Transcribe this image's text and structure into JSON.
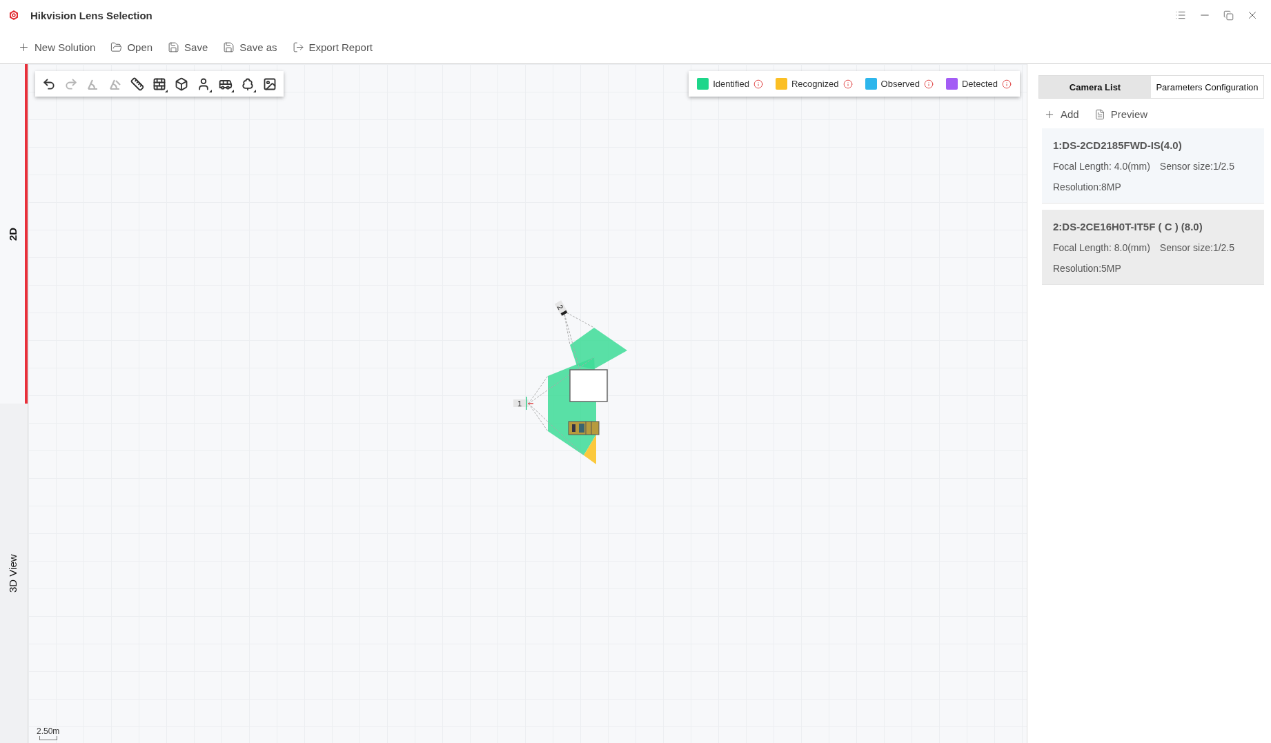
{
  "window": {
    "title": "Hikvision Lens Selection"
  },
  "menu": [
    {
      "kind": "new",
      "label": "New Solution"
    },
    {
      "kind": "open",
      "label": "Open"
    },
    {
      "kind": "save",
      "label": "Save"
    },
    {
      "kind": "saveas",
      "label": "Save as"
    },
    {
      "kind": "export",
      "label": "Export Report"
    }
  ],
  "view_tabs": [
    {
      "label": "2D",
      "selected": true
    },
    {
      "label": "3D View",
      "selected": false
    }
  ],
  "tools": [
    {
      "kind": "undo",
      "disabled": false,
      "submenu": false
    },
    {
      "kind": "redo",
      "disabled": true,
      "submenu": false
    },
    {
      "kind": "angle",
      "disabled": true,
      "submenu": false
    },
    {
      "kind": "angle-cut",
      "disabled": true,
      "submenu": false
    },
    {
      "kind": "ruler",
      "disabled": false,
      "submenu": false
    },
    {
      "kind": "wall",
      "disabled": false,
      "submenu": true
    },
    {
      "kind": "box",
      "disabled": false,
      "submenu": false
    },
    {
      "kind": "person",
      "disabled": false,
      "submenu": true
    },
    {
      "kind": "bus",
      "disabled": false,
      "submenu": true
    },
    {
      "kind": "tree",
      "disabled": false,
      "submenu": true
    },
    {
      "kind": "image",
      "disabled": false,
      "submenu": false
    }
  ],
  "legend": [
    {
      "label": "Identified",
      "color": "#1dd68a"
    },
    {
      "label": "Recognized",
      "color": "#fbbf24"
    },
    {
      "label": "Observed",
      "color": "#2db6ec"
    },
    {
      "label": "Detected",
      "color": "#a35cf5"
    }
  ],
  "canvas": {
    "camera_labels": [
      "1",
      "2"
    ],
    "scale_label": "2.50m"
  },
  "panel_tabs": [
    {
      "label": "Camera List",
      "selected": true
    },
    {
      "label": "Parameters Configuration",
      "selected": false
    }
  ],
  "panel_actions": [
    {
      "kind": "add",
      "label": "Add"
    },
    {
      "kind": "preview",
      "label": "Preview"
    }
  ],
  "cameras": [
    {
      "title": "1:DS-2CD2185FWD-IS(4.0)",
      "focal_length": "Focal Length: 4.0(mm)",
      "sensor_size": "Sensor size:1/2.5",
      "resolution": "Resolution:8MP",
      "selected": false
    },
    {
      "title": "2:DS-2CE16H0T-IT5F ( C ) (8.0)",
      "focal_length": "Focal Length: 8.0(mm)",
      "sensor_size": "Sensor size:1/2.5",
      "resolution": "Resolution:5MP",
      "selected": true
    }
  ]
}
